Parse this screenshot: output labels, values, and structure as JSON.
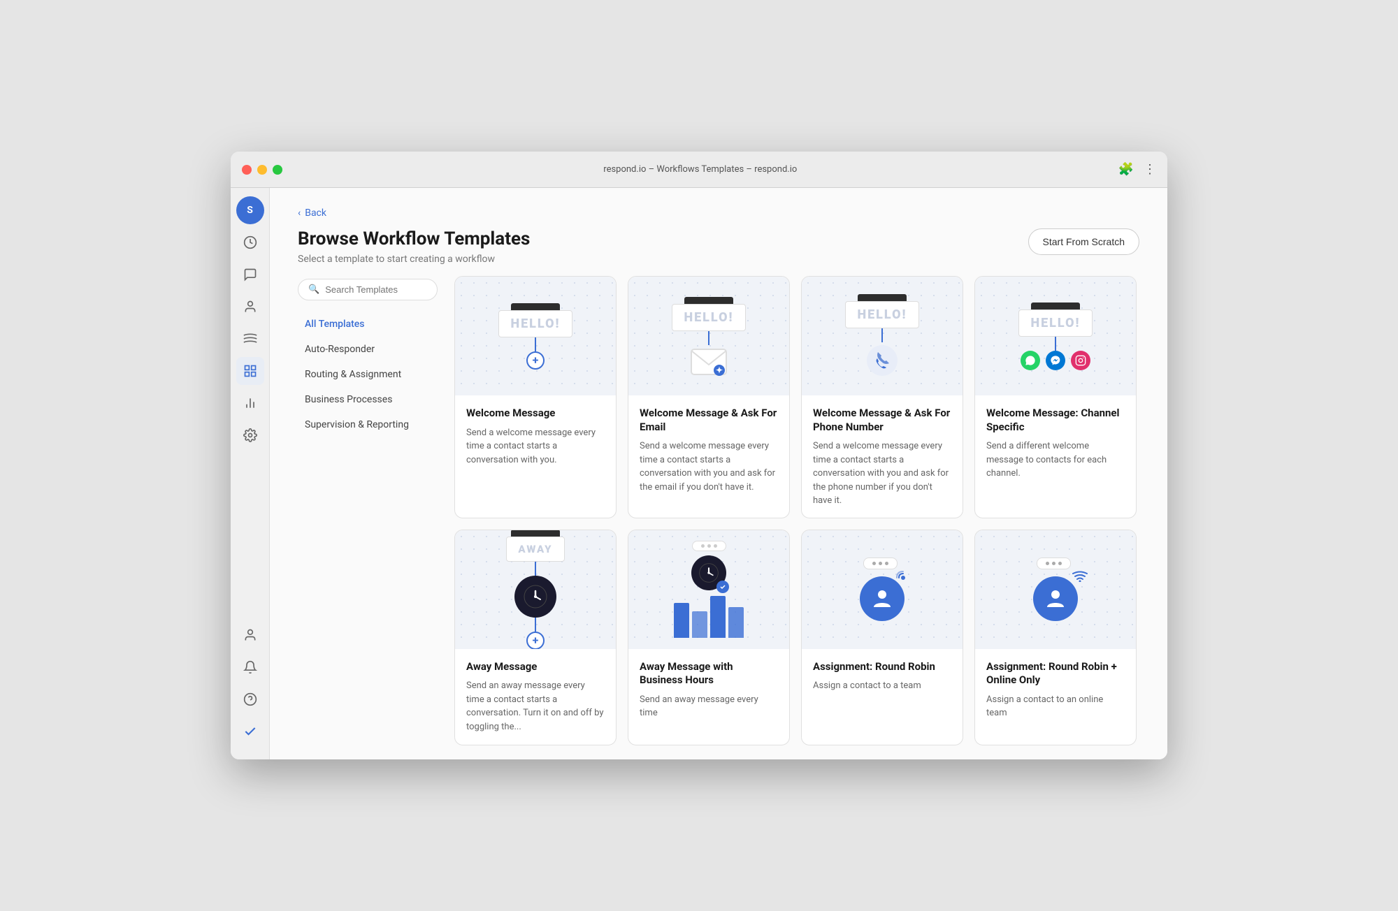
{
  "window": {
    "title": "respond.io – Workflows Templates – respond.io"
  },
  "header": {
    "back_label": "Back",
    "page_title": "Browse Workflow Templates",
    "page_subtitle": "Select a template to start creating a workflow",
    "start_scratch_label": "Start From Scratch"
  },
  "sidebar_icons": [
    {
      "name": "avatar",
      "label": "S",
      "type": "avatar"
    },
    {
      "name": "dashboard",
      "label": "⚡",
      "type": "icon"
    },
    {
      "name": "conversations",
      "label": "💬",
      "type": "icon"
    },
    {
      "name": "contacts",
      "label": "👤",
      "type": "icon"
    },
    {
      "name": "broadcast",
      "label": "📡",
      "type": "icon"
    },
    {
      "name": "workflows",
      "label": "⊞",
      "type": "icon",
      "active": true
    },
    {
      "name": "reports",
      "label": "📊",
      "type": "icon"
    },
    {
      "name": "settings",
      "label": "⚙",
      "type": "icon"
    }
  ],
  "sidebar_bottom": [
    {
      "name": "user-profile",
      "label": "👤"
    },
    {
      "name": "notifications",
      "label": "🔔"
    },
    {
      "name": "help",
      "label": "❓"
    },
    {
      "name": "check",
      "label": "✓"
    }
  ],
  "filter": {
    "search_placeholder": "Search Templates",
    "categories": [
      {
        "id": "all",
        "label": "All Templates",
        "active": true
      },
      {
        "id": "auto-responder",
        "label": "Auto-Responder",
        "active": false
      },
      {
        "id": "routing",
        "label": "Routing & Assignment",
        "active": false
      },
      {
        "id": "business",
        "label": "Business Processes",
        "active": false
      },
      {
        "id": "supervision",
        "label": "Supervision & Reporting",
        "active": false
      }
    ]
  },
  "templates": [
    {
      "id": "welcome-message",
      "title": "Welcome Message",
      "description": "Send a welcome message every time a contact starts a conversation with you.",
      "illustration": "welcome"
    },
    {
      "id": "welcome-email",
      "title": "Welcome Message & Ask For Email",
      "description": "Send a welcome message every time a contact starts a conversation with you and ask for the email if you don't have it.",
      "illustration": "welcome-email"
    },
    {
      "id": "welcome-phone",
      "title": "Welcome Message & Ask For Phone Number",
      "description": "Send a welcome message every time a contact starts a conversation with you and ask for the phone number if you don't have it.",
      "illustration": "welcome-phone"
    },
    {
      "id": "welcome-channel",
      "title": "Welcome Message: Channel Specific",
      "description": "Send a different welcome message to contacts for each channel.",
      "illustration": "welcome-channel"
    },
    {
      "id": "away-message",
      "title": "Away Message",
      "description": "Send an away message every time a contact starts a conversation. Turn it on and off by toggling the...",
      "illustration": "away"
    },
    {
      "id": "away-biz-hours",
      "title": "Away Message with Business Hours",
      "description": "Send an away message every time",
      "illustration": "away-biz"
    },
    {
      "id": "round-robin",
      "title": "Assignment: Round Robin",
      "description": "Assign a contact to a team",
      "illustration": "round-robin"
    },
    {
      "id": "round-robin-online",
      "title": "Assignment: Round Robin + Online Only",
      "description": "Assign a contact to an online team",
      "illustration": "round-robin-online"
    }
  ]
}
